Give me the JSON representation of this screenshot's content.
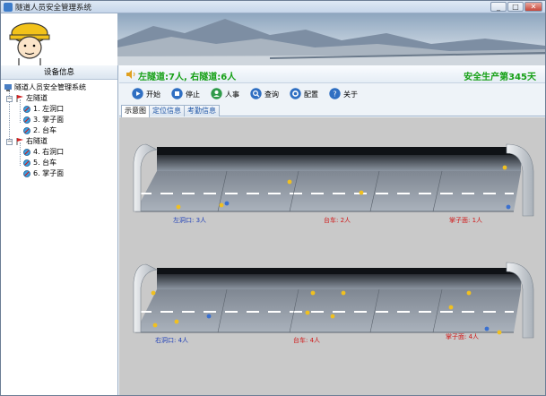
{
  "window": {
    "title": "隧道人员安全管理系统",
    "minimize": "_",
    "maximize": "□",
    "close": "✕"
  },
  "sidebar": {
    "header": "设备信息",
    "root": "隧道人员安全管理系统",
    "groups": [
      {
        "label": "左隧道",
        "items": [
          "1. 左洞口",
          "3. 掌子面",
          "2. 台车"
        ]
      },
      {
        "label": "右隧道",
        "items": [
          "4. 右洞口",
          "5. 台车",
          "6. 掌子面"
        ]
      }
    ]
  },
  "status": {
    "counts": "左隧道:7人, 右隧道:6人",
    "days": "安全生产第345天"
  },
  "toolbar": {
    "start": "开始",
    "stop": "停止",
    "personnel": "人事",
    "query": "查询",
    "config": "配置",
    "about": "关于"
  },
  "tabs": [
    "示意图",
    "定位信息",
    "考勤信息"
  ],
  "tunnels": {
    "left": {
      "entrance": "左洞口: 3人",
      "trolley": "台车: 2人",
      "face": "掌子面: 1人"
    },
    "right": {
      "entrance": "右洞口: 4人",
      "trolley": "台车: 4人",
      "face": "掌子面: 4人"
    }
  },
  "colors": {
    "accent_green": "#16a016",
    "label_blue": "#1f3fb8",
    "label_red": "#d01818"
  }
}
